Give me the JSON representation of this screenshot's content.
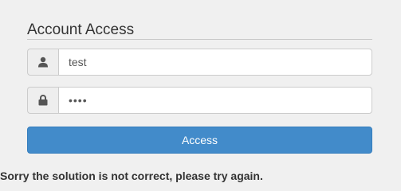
{
  "form": {
    "title": "Account Access",
    "username": {
      "value": "test",
      "icon": "user-icon"
    },
    "password": {
      "value": "••••",
      "icon": "lock-icon"
    },
    "submit_label": "Access"
  },
  "message": {
    "text": "Sorry the solution is not correct, please try again."
  },
  "colors": {
    "primary": "#428bca",
    "background": "#f0f0f0"
  }
}
